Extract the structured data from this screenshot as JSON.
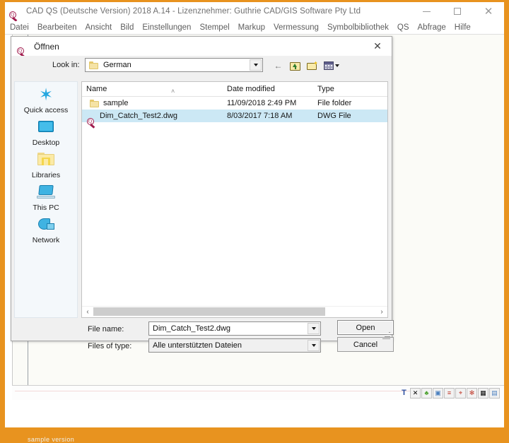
{
  "app": {
    "title": "CAD QS (Deutsche Version) 2018 A.14 - Lizenznehmer: Guthrie CAD/GIS Software Pty Ltd",
    "icon": "magnifier-qs-icon",
    "window_controls": {
      "minimize": "–",
      "maximize": "□",
      "close": "✕"
    },
    "frame_color": "#e8931f",
    "watermark": "sample version"
  },
  "menu": {
    "items": [
      {
        "label": "Datei"
      },
      {
        "label": "Bearbeiten"
      },
      {
        "label": "Ansicht"
      },
      {
        "label": "Bild"
      },
      {
        "label": "Einstellungen"
      },
      {
        "label": "Stempel"
      },
      {
        "label": "Markup"
      },
      {
        "label": "Vermessung"
      },
      {
        "label": "Symbolbibliothek"
      },
      {
        "label": "QS"
      },
      {
        "label": "Abfrage"
      },
      {
        "label": "Hilfe"
      }
    ]
  },
  "dialog": {
    "title": "Öffnen",
    "icon": "magnifier-qs-icon",
    "close_label": "✕",
    "lookin": {
      "label": "Look in:",
      "value": "German",
      "icon": "folder-icon",
      "arrow": "chevron-down-icon"
    },
    "toolbar": [
      {
        "name": "back-button",
        "glyph": "←"
      },
      {
        "name": "up-folder-button",
        "glyph": "up-folder-icon"
      },
      {
        "name": "new-folder-button",
        "glyph": "new-folder-icon"
      },
      {
        "name": "views-button",
        "glyph": "views-grid-icon"
      }
    ],
    "places": [
      {
        "label": "Quick access",
        "icon": "star-icon"
      },
      {
        "label": "Desktop",
        "icon": "monitor-icon"
      },
      {
        "label": "Libraries",
        "icon": "library-folder-icon"
      },
      {
        "label": "This PC",
        "icon": "computer-icon"
      },
      {
        "label": "Network",
        "icon": "network-icon"
      }
    ],
    "file_list": {
      "columns": [
        "Name",
        "Date modified",
        "Type"
      ],
      "sort_indicator": "˄",
      "rows": [
        {
          "name": "sample",
          "date_modified": "11/09/2018 2:49 PM",
          "type": "File folder",
          "icon": "folder-icon",
          "selected": false
        },
        {
          "name": "Dim_Catch_Test2.dwg",
          "date_modified": "8/03/2017 7:18 AM",
          "type": "DWG File",
          "icon": "dwg-file-icon",
          "selected": true
        }
      ],
      "selection_color": "#cce8f5"
    },
    "scrollbar": {
      "left_arrow": "‹",
      "right_arrow": "›"
    },
    "filename": {
      "label": "File name:",
      "value": "Dim_Catch_Test2.dwg",
      "arrow": "chevron-down-icon"
    },
    "filetype": {
      "label": "Files of type:",
      "value": "Alle unterstützten Dateien",
      "arrow": "chevron-down-icon"
    },
    "buttons": {
      "open": "Open",
      "cancel": "Cancel"
    }
  },
  "status_bar": {
    "icons": [
      {
        "name": "text-tool-icon",
        "glyph": "T"
      },
      {
        "name": "close-tool-icon",
        "glyph": "✕"
      },
      {
        "name": "leaf-tool-icon",
        "glyph": "♣"
      },
      {
        "name": "window-tool-icon",
        "glyph": "▣"
      },
      {
        "name": "lightning-tool-icon",
        "glyph": "≡"
      },
      {
        "name": "measure-tool-icon",
        "glyph": "⌖"
      },
      {
        "name": "stamp-tool-icon",
        "glyph": "✻"
      },
      {
        "name": "checker-tool-icon",
        "glyph": "▦"
      },
      {
        "name": "image-tool-icon",
        "glyph": "▤"
      }
    ]
  }
}
